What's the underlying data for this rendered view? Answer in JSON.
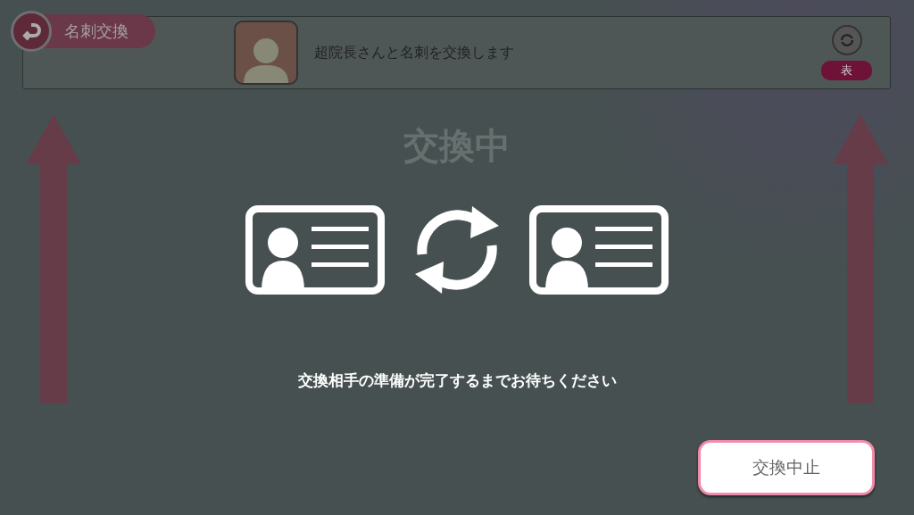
{
  "header": {
    "title": "名刺交換"
  },
  "partner": {
    "message": "超院長さんと名刺を交換します",
    "side_label": "表"
  },
  "status": {
    "title": "交換中",
    "message": "交換相手の準備が完了するまでお待ちください"
  },
  "buttons": [
    {
      "label": "交換中止"
    }
  ]
}
